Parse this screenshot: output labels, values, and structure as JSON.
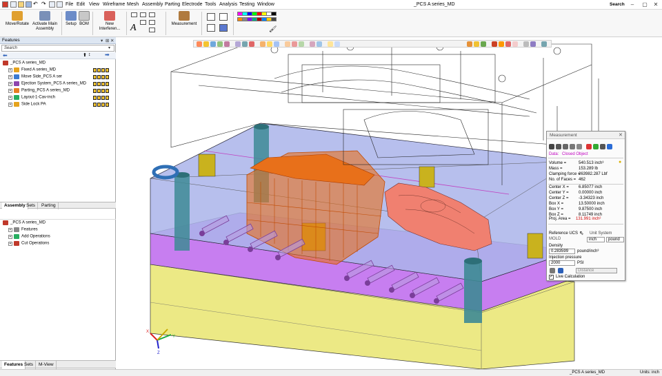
{
  "window": {
    "title": "_PCS A series_MD"
  },
  "menu": [
    "File",
    "Edit",
    "View",
    "Wireframe",
    "Mesh",
    "Assembly",
    "Parting",
    "Electrode",
    "Tools",
    "Analysis",
    "Testing",
    "Window"
  ],
  "search": {
    "label": "Search"
  },
  "ribbon": {
    "move_rotate": "Move/Rotate",
    "activate_main_line1": "Activate Main",
    "activate_main_line2": "Assembly",
    "setup": "Setup",
    "bom": "BOM",
    "new_interference_line1": "New",
    "new_interference_line2": "Interferen...",
    "measurement": "Measurement",
    "palette": [
      "#ff00ff",
      "#00ffff",
      "#0000ff",
      "#00ff00",
      "#ff0000",
      "#ffff00",
      "#ffffff",
      "#000000",
      "#ff8800",
      "#888888",
      "#8800ff",
      "#00aa88",
      "#aa0000",
      "#0088ff",
      "#ffcc00",
      "#444444"
    ]
  },
  "features_panel": {
    "title": "Features",
    "search_placeholder": "Search",
    "tree": [
      {
        "label": "_PCS A series_MD",
        "level": 0
      },
      {
        "label": "Fixed A series_MD",
        "level": 1
      },
      {
        "label": "Move Side_PCS A ser",
        "level": 1
      },
      {
        "label": "Ejection System_PCS A series_MD",
        "level": 1
      },
      {
        "label": "Parting_PCS A series_MD",
        "level": 1
      },
      {
        "label": "Layout-1-Cav-inch",
        "level": 1
      },
      {
        "label": "Side Lock PA",
        "level": 1
      }
    ],
    "mid_tabs": [
      "Assembly",
      "Sets",
      "Parting"
    ],
    "lower_tree": [
      {
        "label": "_PCS A series_MD",
        "level": 0
      },
      {
        "label": "Features",
        "level": 1
      },
      {
        "label": "Add Operations",
        "level": 1
      },
      {
        "label": "Cut Operations",
        "level": 1
      }
    ],
    "bottom_tabs": [
      "Features",
      "Sets",
      "M-View"
    ]
  },
  "measurement": {
    "title": "Measurement",
    "data_label": "Data:",
    "data_value": "Closed Object",
    "rows": [
      {
        "label": "Volume =",
        "value": "540.513 inch³"
      },
      {
        "label": "Mass =",
        "value": "153.289 lb"
      },
      {
        "label": "Clamping force =",
        "value": "263982.287 Lbf"
      },
      {
        "label": "No. of Faces =",
        "value": "462"
      }
    ],
    "rows2": [
      {
        "label": "Center X =",
        "value": "6.85077 inch"
      },
      {
        "label": "Center Y =",
        "value": "0.00000 inch"
      },
      {
        "label": "Center Z =",
        "value": "-3.34323 inch"
      },
      {
        "label": "Box X =",
        "value": "13.50000 inch"
      },
      {
        "label": "Box Y =",
        "value": "9.87500 inch"
      },
      {
        "label": "Box Z =",
        "value": "8.11749 inch"
      }
    ],
    "proj_area_label": "Proj. Area =",
    "proj_area_value": "131.991 inch²",
    "reference_ucs_label": "Reference UCS",
    "reference_ucs_value": "MOLD",
    "unit_system_label": "Unit System",
    "unit_length": "inch",
    "unit_mass": "pound",
    "density_label": "Density",
    "density_value": "0.283599",
    "density_unit": "pound/inch³",
    "injection_label": "Injection pressure",
    "injection_value": "2000",
    "injection_unit": "PSI",
    "distance_option": "Distance",
    "live_calc_label": "Live Calculation"
  },
  "statusbar": {
    "file": "_PCS A series_MD",
    "units": "Units: inch"
  },
  "axis": {
    "x": "X",
    "y": "Y",
    "z": "Z"
  },
  "colors": {
    "cavity_orange": "#e8701a",
    "part_salmon": "#f08070",
    "plate_blue": "#aab4ea",
    "plate_purple": "#c77ef0",
    "plate_yellow": "#ece985"
  }
}
